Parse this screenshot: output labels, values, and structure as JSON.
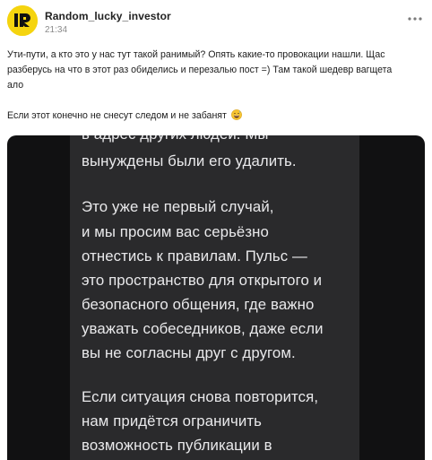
{
  "post": {
    "author": "Random_lucky_investor",
    "time": "21:34",
    "paragraph1_line1": "Ути-пути, а кто это у нас тут такой ранимый? Опять какие-то провокации нашли. Щас",
    "paragraph1_line2": "разберусь на что в этот раз обиделись и перезалью пост =) Там такой шедевр вагщета",
    "paragraph1_line3": "ало",
    "paragraph2": "Если этот конечно не снесут следом и не забанят",
    "paragraph2_emoji": "grinning-sweat-emoji",
    "avatar_color": "#f5d40f"
  },
  "screenshot": {
    "background": "#2a2a2c",
    "lines": [
      "в адрес других людей. Мы",
      "вынуждены были его удалить.",
      "Это уже не первый случай,",
      "и мы просим вас серьёзно",
      "отнестись к правилам. Пульс —",
      "это пространство для открытого и",
      "безопасного общения, где важно",
      "уважать собеседников, даже если",
      "вы не согласны друг с другом.",
      "Если ситуация снова повторится,",
      "нам придётся ограничить",
      "возможность публикации в"
    ]
  }
}
